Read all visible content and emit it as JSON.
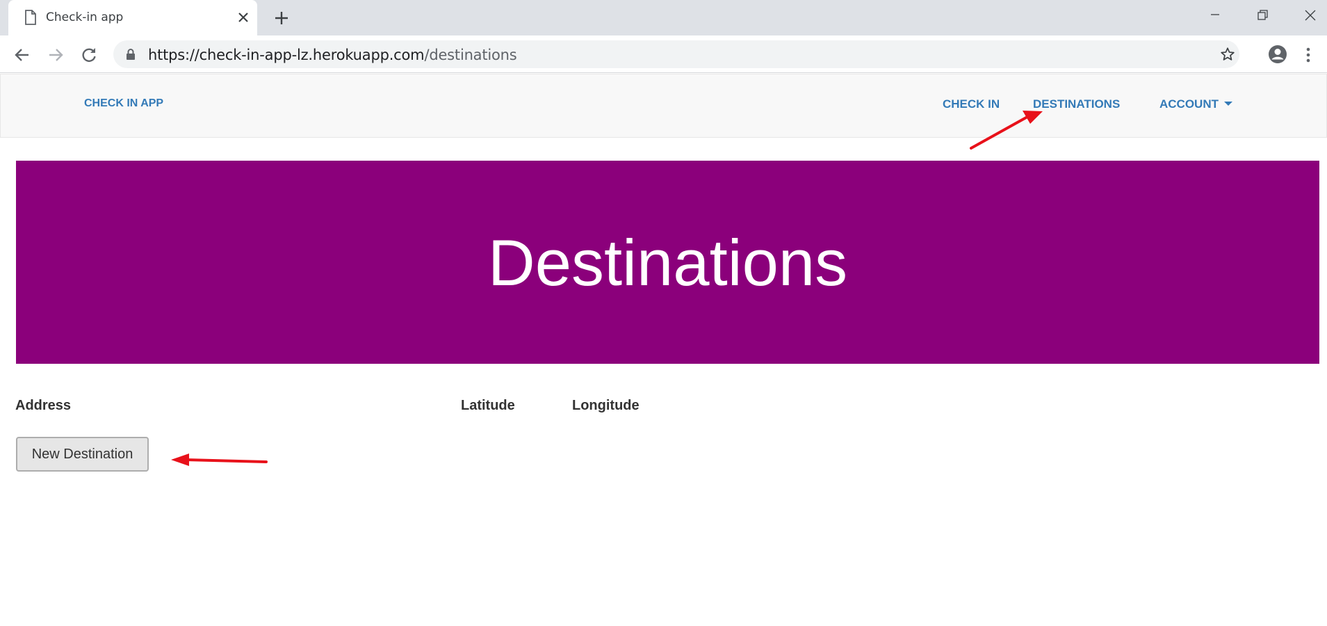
{
  "browser": {
    "tab_title": "Check-in app",
    "url_host": "https://check-in-app-lz.herokuapp.com",
    "url_path": "/destinations"
  },
  "navbar": {
    "brand": "CHECK IN APP",
    "links": [
      {
        "label": "CHECK IN"
      },
      {
        "label": "DESTINATIONS"
      },
      {
        "label": "ACCOUNT"
      }
    ],
    "link_color": "#337ab7"
  },
  "jumbotron": {
    "title": "Destinations",
    "background": "#8b007b"
  },
  "table": {
    "headers": [
      "Address",
      "Latitude",
      "Longitude"
    ],
    "rows": []
  },
  "actions": {
    "new_destination": "New Destination"
  },
  "annotations": {
    "arrow_color": "#e8111a"
  }
}
